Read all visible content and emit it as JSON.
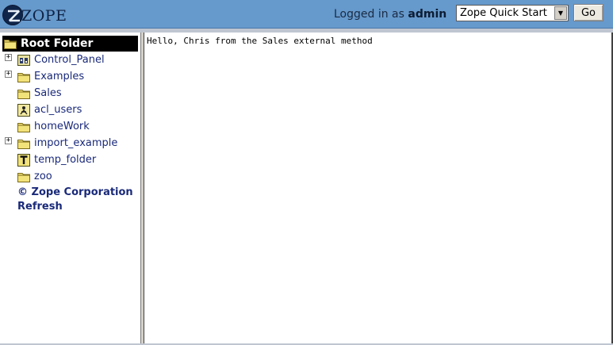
{
  "header": {
    "logo_text": "ZOPE",
    "login_prefix": "Logged in as",
    "username": "admin",
    "quick_select": {
      "selected": "Zope Quick Start"
    },
    "go_label": "Go"
  },
  "tree": {
    "root_label": "Root Folder",
    "items": [
      {
        "label": "Control_Panel",
        "icon": "control-panel-icon",
        "expandable": true
      },
      {
        "label": "Examples",
        "icon": "folder-icon",
        "expandable": true
      },
      {
        "label": "Sales",
        "icon": "folder-icon",
        "expandable": false
      },
      {
        "label": "acl_users",
        "icon": "user-folder-icon",
        "expandable": false
      },
      {
        "label": "homeWork",
        "icon": "folder-icon",
        "expandable": false
      },
      {
        "label": "import_example",
        "icon": "folder-icon",
        "expandable": true
      },
      {
        "label": "temp_folder",
        "icon": "temporary-folder-icon",
        "expandable": false
      },
      {
        "label": "zoo",
        "icon": "folder-icon",
        "expandable": false
      }
    ],
    "copyright_label": "© Zope Corporation",
    "refresh_label": "Refresh"
  },
  "main": {
    "output_text": "Hello, Chris from the Sales external method"
  },
  "colors": {
    "header_bg": "#6699cc",
    "link": "#1a2a7a",
    "root_row_bg": "#000000"
  }
}
